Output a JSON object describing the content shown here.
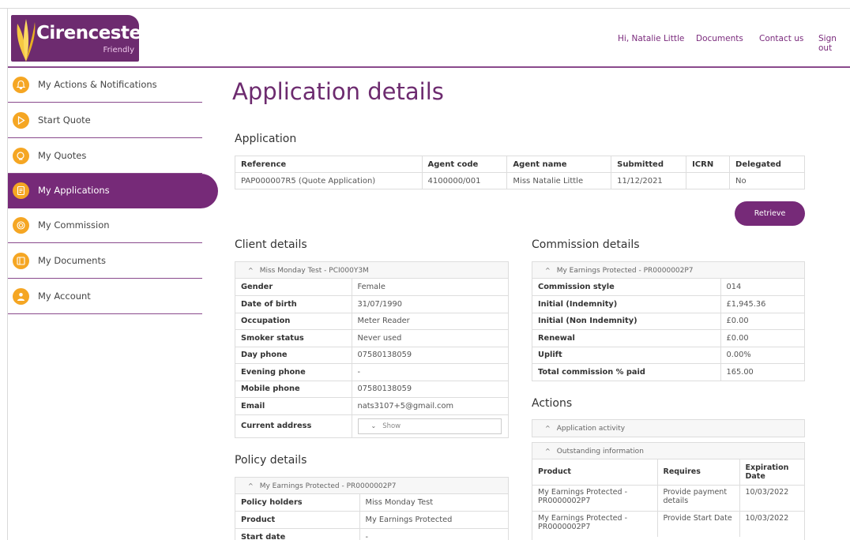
{
  "brand": {
    "title": "Cirencester",
    "subtitle": "Friendly"
  },
  "topnav": {
    "greeting": "Hi, Natalie Little",
    "documents": "Documents",
    "contact": "Contact us",
    "signout": "Sign out"
  },
  "sidebar": {
    "items": [
      {
        "label": "My Actions & Notifications",
        "icon": "bell-icon"
      },
      {
        "label": "Start Quote",
        "icon": "play-icon"
      },
      {
        "label": "My Quotes",
        "icon": "quotes-icon"
      },
      {
        "label": "My Applications",
        "icon": "applications-icon",
        "active": true
      },
      {
        "label": "My Commission",
        "icon": "commission-icon"
      },
      {
        "label": "My Documents",
        "icon": "documents-icon"
      },
      {
        "label": "My Account",
        "icon": "user-icon"
      }
    ]
  },
  "page": {
    "title": "Application details"
  },
  "application": {
    "section_title": "Application",
    "headers": [
      "Reference",
      "Agent code",
      "Agent name",
      "Submitted",
      "ICRN",
      "Delegated"
    ],
    "row": [
      "PAP000007R5 (Quote Application)",
      "4100000/001",
      "Miss Natalie Little",
      "11/12/2021",
      "",
      "No"
    ],
    "retrieve_label": "Retrieve"
  },
  "client": {
    "section_title": "Client details",
    "card_header": "Miss Monday Test - PCI000Y3M",
    "rows": [
      {
        "k": "Gender",
        "v": "Female"
      },
      {
        "k": "Date of birth",
        "v": "31/07/1990"
      },
      {
        "k": "Occupation",
        "v": "Meter Reader"
      },
      {
        "k": "Smoker status",
        "v": "Never used"
      },
      {
        "k": "Day phone",
        "v": "07580138059"
      },
      {
        "k": "Evening phone",
        "v": "-"
      },
      {
        "k": "Mobile phone",
        "v": "07580138059"
      },
      {
        "k": "Email",
        "v": "nats3107+5@gmail.com"
      }
    ],
    "address_label": "Current address",
    "address_show": "Show"
  },
  "commission": {
    "section_title": "Commission details",
    "card_header": "My Earnings Protected - PR0000002P7",
    "rows": [
      {
        "k": "Commission style",
        "v": "014"
      },
      {
        "k": "Initial (Indemnity)",
        "v": "£1,945.36"
      },
      {
        "k": "Initial (Non Indemnity)",
        "v": "£0.00"
      },
      {
        "k": "Renewal",
        "v": "£0.00"
      },
      {
        "k": "Uplift",
        "v": "0.00%"
      },
      {
        "k": "Total commission % paid",
        "v": "165.00"
      }
    ]
  },
  "actions": {
    "section_title": "Actions",
    "activity_header": "Application activity",
    "outstanding_header": "Outstanding information",
    "headers": [
      "Product",
      "Requires",
      "Expiration Date"
    ],
    "rows": [
      [
        "My Earnings Protected - PR0000002P7",
        "Provide payment details",
        "10/03/2022"
      ],
      [
        "My Earnings Protected - PR0000002P7",
        "Provide Start Date",
        "10/03/2022"
      ]
    ]
  },
  "policy": {
    "section_title": "Policy details",
    "card_header": "My Earnings Protected - PR0000002P7",
    "rows": [
      {
        "k": "Policy holders",
        "v": "Miss Monday Test"
      },
      {
        "k": "Product",
        "v": "My Earnings Protected"
      },
      {
        "k": "Start date",
        "v": "-"
      }
    ]
  }
}
